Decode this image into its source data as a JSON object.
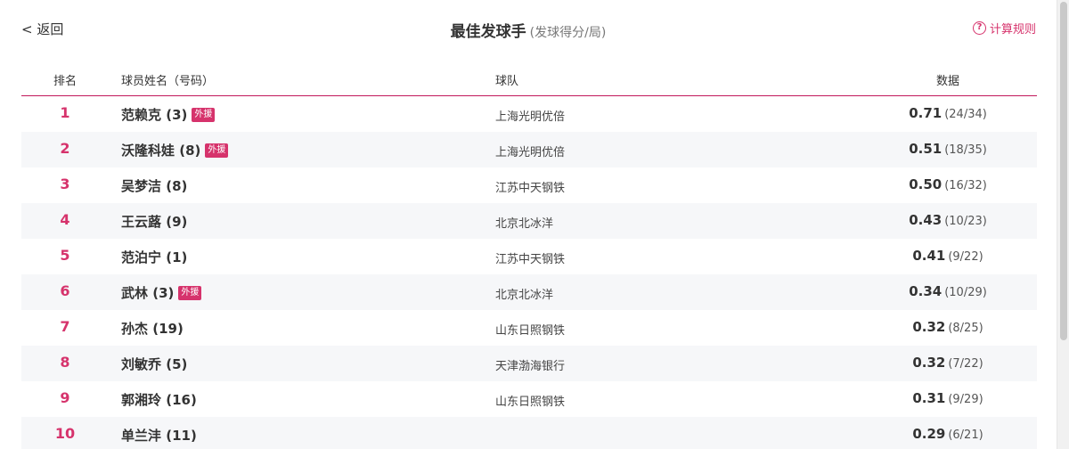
{
  "header": {
    "back_label": "< 返回",
    "title": "最佳发球手",
    "subtitle": "(发球得分/局)",
    "rules_label": "计算规则",
    "rules_icon": "question-circle-icon"
  },
  "table": {
    "columns": {
      "rank": "排名",
      "name": "球员姓名（号码）",
      "team": "球队",
      "data": "数据"
    },
    "rows": [
      {
        "rank": "1",
        "name": "范赖克 (3)",
        "badge": "外援",
        "team": "上海光明优倍",
        "value": "0.71",
        "frac": "(24/34)"
      },
      {
        "rank": "2",
        "name": "沃隆科娃 (8)",
        "badge": "外援",
        "team": "上海光明优倍",
        "value": "0.51",
        "frac": "(18/35)"
      },
      {
        "rank": "3",
        "name": "吴梦洁 (8)",
        "badge": "",
        "team": "江苏中天钢铁",
        "value": "0.50",
        "frac": "(16/32)"
      },
      {
        "rank": "4",
        "name": "王云蕗 (9)",
        "badge": "",
        "team": "北京北冰洋",
        "value": "0.43",
        "frac": "(10/23)"
      },
      {
        "rank": "5",
        "name": "范泊宁 (1)",
        "badge": "",
        "team": "江苏中天钢铁",
        "value": "0.41",
        "frac": "(9/22)"
      },
      {
        "rank": "6",
        "name": "武林 (3)",
        "badge": "外援",
        "team": "北京北冰洋",
        "value": "0.34",
        "frac": "(10/29)"
      },
      {
        "rank": "7",
        "name": "孙杰 (19)",
        "badge": "",
        "team": "山东日照钢铁",
        "value": "0.32",
        "frac": "(8/25)"
      },
      {
        "rank": "8",
        "name": "刘敏乔 (5)",
        "badge": "",
        "team": "天津渤海银行",
        "value": "0.32",
        "frac": "(7/22)"
      },
      {
        "rank": "9",
        "name": "郭湘玲 (16)",
        "badge": "",
        "team": "山东日照钢铁",
        "value": "0.31",
        "frac": "(9/29)"
      },
      {
        "rank": "10",
        "name": "单兰沣 (11)",
        "badge": "",
        "team": "",
        "value": "0.29",
        "frac": "(6/21)"
      }
    ]
  }
}
